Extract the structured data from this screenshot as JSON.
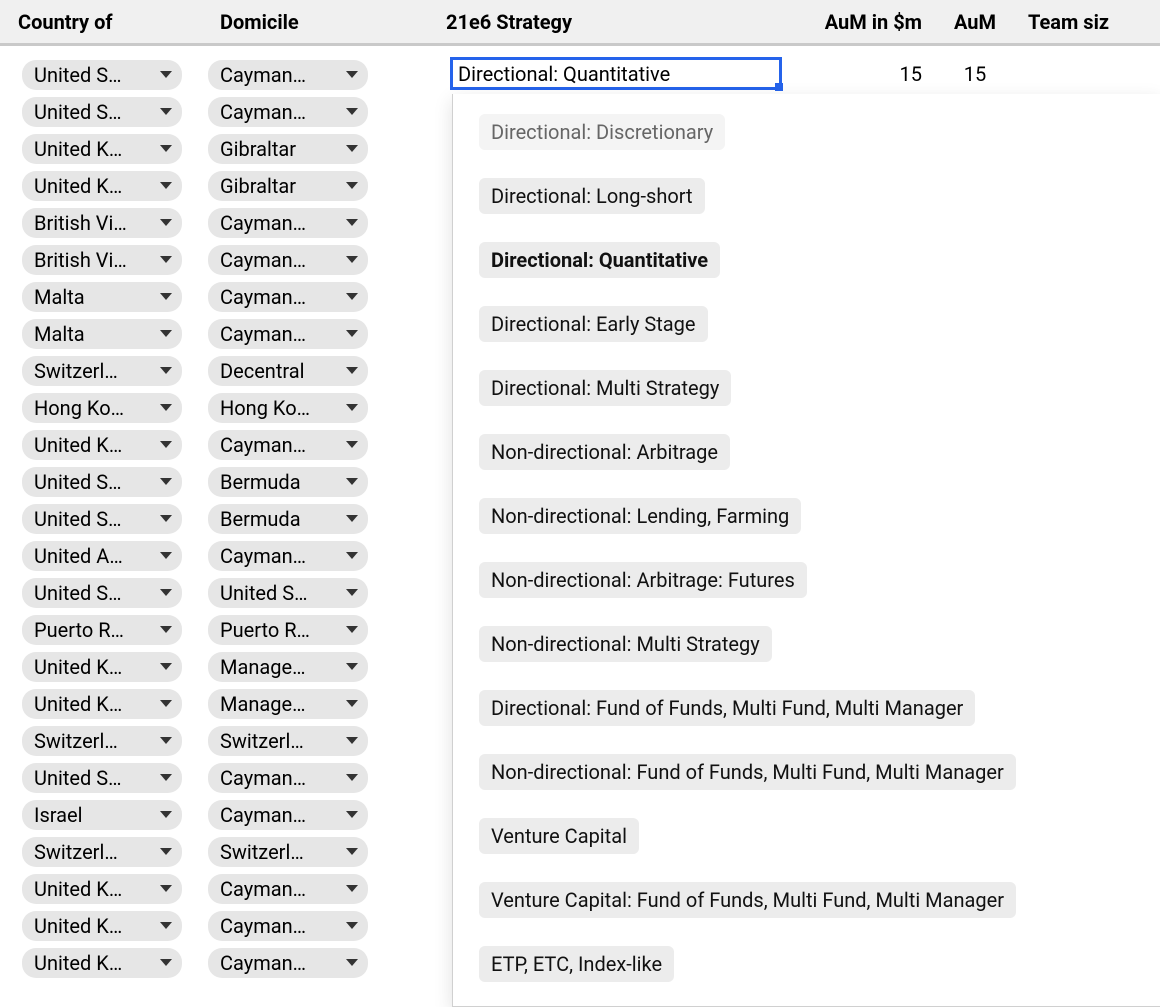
{
  "headers": {
    "country": "Country of",
    "domicile": "Domicile",
    "strategy": "21e6 Strategy",
    "aum_m": "AuM in $m",
    "aum": "AuM",
    "team": "Team siz"
  },
  "selected_strategy": "Directional: Quantitative",
  "row_values": {
    "aum_m": "15",
    "aum": "15"
  },
  "rows": [
    {
      "country": "United S…",
      "domicile": "Cayman…"
    },
    {
      "country": "United S…",
      "domicile": "Cayman…"
    },
    {
      "country": "United K…",
      "domicile": "Gibraltar"
    },
    {
      "country": "United K…",
      "domicile": "Gibraltar"
    },
    {
      "country": "British Vi…",
      "domicile": "Cayman…"
    },
    {
      "country": "British Vi…",
      "domicile": "Cayman…"
    },
    {
      "country": "Malta",
      "domicile": "Cayman…"
    },
    {
      "country": "Malta",
      "domicile": "Cayman…"
    },
    {
      "country": "Switzerl…",
      "domicile": "Decentral"
    },
    {
      "country": "Hong Ko…",
      "domicile": "Hong Ko…"
    },
    {
      "country": "United K…",
      "domicile": "Cayman…"
    },
    {
      "country": "United S…",
      "domicile": "Bermuda"
    },
    {
      "country": "United S…",
      "domicile": "Bermuda"
    },
    {
      "country": "United A…",
      "domicile": "Cayman…"
    },
    {
      "country": "United S…",
      "domicile": "United S…"
    },
    {
      "country": "Puerto R…",
      "domicile": "Puerto R…"
    },
    {
      "country": "United K…",
      "domicile": "Manage…"
    },
    {
      "country": "United K…",
      "domicile": "Manage…"
    },
    {
      "country": "Switzerl…",
      "domicile": "Switzerl…"
    },
    {
      "country": "United S…",
      "domicile": "Cayman…"
    },
    {
      "country": "Israel",
      "domicile": "Cayman…"
    },
    {
      "country": "Switzerl…",
      "domicile": "Switzerl…"
    },
    {
      "country": "United K…",
      "domicile": "Cayman…"
    },
    {
      "country": "United K…",
      "domicile": "Cayman…"
    },
    {
      "country": "United K…",
      "domicile": "Cayman…"
    }
  ],
  "options": [
    {
      "label": "Directional: Discretionary",
      "state": "highlight"
    },
    {
      "label": "Directional: Long-short",
      "state": ""
    },
    {
      "label": "Directional: Quantitative",
      "state": "current"
    },
    {
      "label": "Directional: Early Stage",
      "state": ""
    },
    {
      "label": "Directional: Multi Strategy",
      "state": ""
    },
    {
      "label": "Non-directional: Arbitrage",
      "state": ""
    },
    {
      "label": "Non-directional: Lending, Farming",
      "state": ""
    },
    {
      "label": "Non-directional: Arbitrage: Futures",
      "state": ""
    },
    {
      "label": "Non-directional: Multi Strategy",
      "state": ""
    },
    {
      "label": "Directional: Fund of Funds, Multi Fund, Multi Manager",
      "state": ""
    },
    {
      "label": "Non-directional: Fund of Funds, Multi Fund, Multi Manager",
      "state": ""
    },
    {
      "label": "Venture Capital",
      "state": ""
    },
    {
      "label": "Venture Capital: Fund of Funds, Multi Fund, Multi Manager",
      "state": ""
    },
    {
      "label": "ETP, ETC, Index-like",
      "state": ""
    }
  ]
}
